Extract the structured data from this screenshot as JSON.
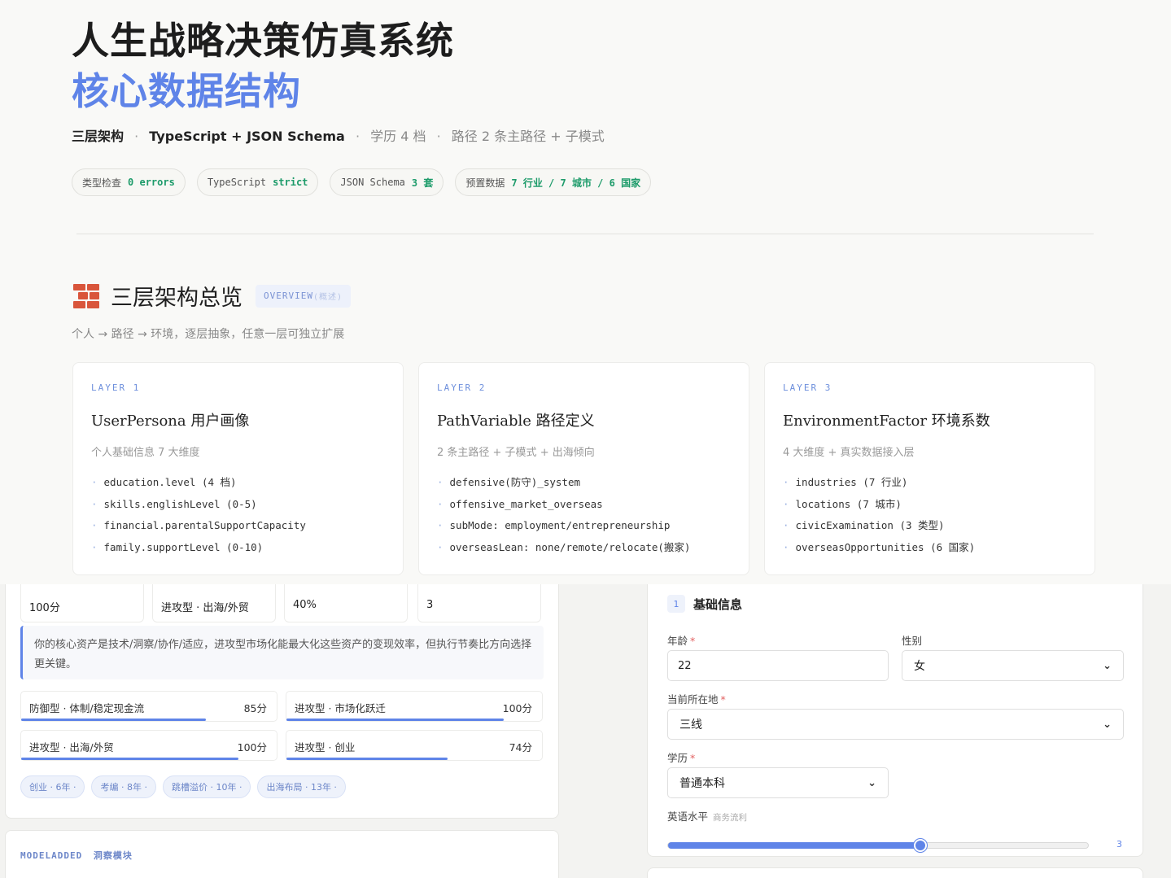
{
  "header": {
    "title": "人生战略决策仿真系统",
    "subtitle_title": "核心数据结构",
    "meta": [
      {
        "text": "三层架构",
        "strong": true
      },
      {
        "text": "TypeScript + JSON Schema",
        "strong": true
      },
      {
        "text": "学历 4 档",
        "strong": false
      },
      {
        "text": "路径 2 条主路径 + 子模式",
        "strong": false
      }
    ],
    "meta_separator": "·"
  },
  "badges": [
    {
      "label": "类型检查",
      "value": "0 errors"
    },
    {
      "label": "TypeScript",
      "value": "strict"
    },
    {
      "label": "JSON Schema",
      "value": "3 套"
    },
    {
      "label": "预置数据",
      "value": "7 行业 / 7 城市 / 6 国家"
    }
  ],
  "overview": {
    "title": "三层架构总览",
    "tag": "OVERVIEW",
    "tag_zh": "(概述)",
    "description": "个人 → 路径 → 环境，逐层抽象，任意一层可独立扩展",
    "icon": "brick-icon"
  },
  "layers": [
    {
      "label": "LAYER 1",
      "title": "UserPersona 用户画像",
      "description": "个人基础信息 7 大维度",
      "items": [
        "education.level (4 档)",
        "skills.englishLevel (0-5)",
        "financial.parentalSupportCapacity",
        "family.supportLevel (0-10)"
      ]
    },
    {
      "label": "LAYER 2",
      "title": "PathVariable 路径定义",
      "description": "2 条主路径 + 子模式 + 出海倾向",
      "items": [
        "defensive(防守)_system",
        "offensive_market_overseas",
        "subMode: employment/entrepreneurship",
        "overseasLean: none/remote/relocate(搬家)"
      ]
    },
    {
      "label": "LAYER 3",
      "title": "EnvironmentFactor 环境系数",
      "description": "4 大维度 + 真实数据接入层",
      "items": [
        "industries (7 行业)",
        "locations (7 城市)",
        "civicExamination (3 类型)",
        "overseasOpportunities (6 国家)"
      ]
    }
  ],
  "result": {
    "stats": [
      "100分",
      "进攻型 · 出海/外贸",
      "40%",
      "3"
    ],
    "insight": "你的核心资产是技术/洞察/协作/适应，进攻型市场化能最大化这些资产的变现效率，但执行节奏比方向选择更关键。",
    "scores": [
      {
        "label": "防御型 · 体制/稳定现金流",
        "points": "85分",
        "value": 85
      },
      {
        "label": "进攻型 · 市场化跃迁",
        "points": "100分",
        "value": 100
      },
      {
        "label": "进攻型 · 出海/外贸",
        "points": "100分",
        "value": 100
      },
      {
        "label": "进攻型 · 创业",
        "points": "74分",
        "value": 74
      }
    ],
    "chips": [
      "创业 · 6年 ·",
      "考编 · 8年 ·",
      "跳槽溢价 · 10年 ·",
      "出海布局 · 13年 ·"
    ]
  },
  "module": {
    "tag": "MODELADDED",
    "tag_zh": "洞察模块"
  },
  "form": {
    "step_number": "1",
    "step_title": "基础信息",
    "age_label": "年龄",
    "age_value": "22",
    "gender_label": "性别",
    "gender_value": "女",
    "location_label": "当前所在地",
    "location_value": "三线",
    "education_label": "学历",
    "education_value": "普通本科",
    "english_label": "英语水平",
    "english_hint": "商务流利",
    "english_value": "3",
    "english_level": 3,
    "english_max": 5,
    "required_mark": "*"
  },
  "colors": {
    "accent": "#5f84e8",
    "success": "#1d9b6a",
    "brick": "#d9553b"
  }
}
